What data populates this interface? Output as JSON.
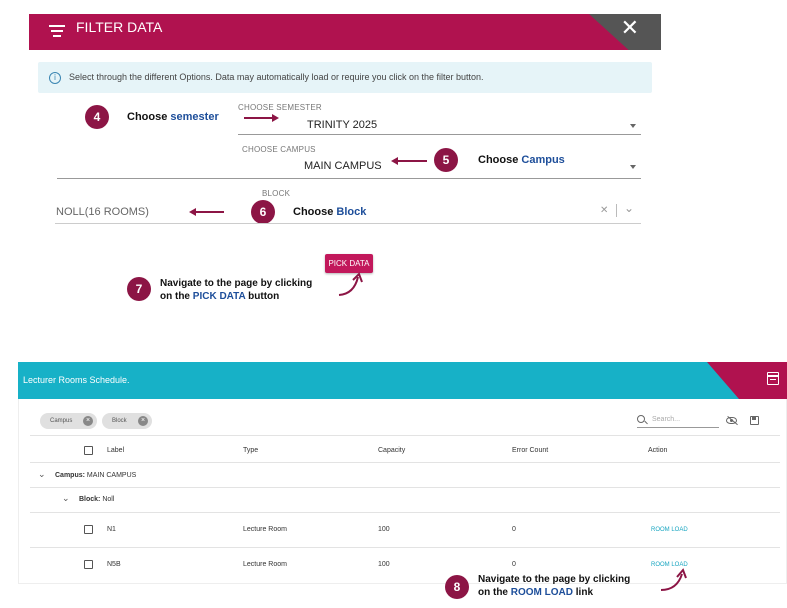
{
  "filter": {
    "title": "FILTER DATA",
    "close_symbol": "✕",
    "info_text": "Select through the different Options. Data may automatically load or require you click on the filter button.",
    "semester": {
      "label": "CHOOSE SEMESTER",
      "value": "TRINITY 2025"
    },
    "campus": {
      "label": "CHOOSE CAMPUS",
      "value": "MAIN CAMPUS"
    },
    "block": {
      "label": "BLOCK",
      "value": "NOLL(16 ROOMS)",
      "clear_symbol": "✕",
      "chevron_symbol": "⌄"
    },
    "pick_button": "PICK DATA"
  },
  "annotations": {
    "step4": {
      "number": "4",
      "text": "Choose ",
      "highlight": "semester"
    },
    "step5": {
      "number": "5",
      "text": "Choose ",
      "highlight": "Campus"
    },
    "step6": {
      "number": "6",
      "text": "Choose ",
      "highlight": "Block"
    },
    "step7": {
      "number": "7",
      "line1": "Navigate to the page by clicking",
      "line2_pre": "on the ",
      "line2_hl": "PICK DATA",
      "line2_post": " button"
    },
    "step8": {
      "number": "8",
      "line1": "Navigate to the page by clicking",
      "line2_pre": "on the ",
      "line2_hl": "ROOM LOAD",
      "line2_post": " link"
    }
  },
  "schedule": {
    "title": "Lecturer Rooms Schedule.",
    "chips": [
      "Campus",
      "Block"
    ],
    "search_placeholder": "Search...",
    "columns": [
      "Label",
      "Type",
      "Capacity",
      "Error Count",
      "Action"
    ],
    "group_campus": {
      "key": "Campus:",
      "value": "MAIN CAMPUS"
    },
    "group_block": {
      "key": "Block:",
      "value": "Noll"
    },
    "rows": [
      {
        "label": "N1",
        "type": "Lecture Room",
        "capacity": "100",
        "errors": "0",
        "action": "ROOM LOAD"
      },
      {
        "label": "N5B",
        "type": "Lecture Room",
        "capacity": "100",
        "errors": "0",
        "action": "ROOM LOAD"
      }
    ]
  },
  "colors": {
    "brand": "#b0124f",
    "teal": "#17b1c7",
    "badge": "#8c1545",
    "highlight": "#1d4e9a"
  },
  "icons": [
    "menu-icon",
    "close-icon",
    "info-icon",
    "dropdown-caret-icon",
    "clear-icon",
    "chevron-down-icon",
    "calendar-icon",
    "search-icon",
    "eye-off-icon",
    "save-icon",
    "checkbox-icon",
    "expand-chevron-icon",
    "curved-arrow-icon"
  ]
}
